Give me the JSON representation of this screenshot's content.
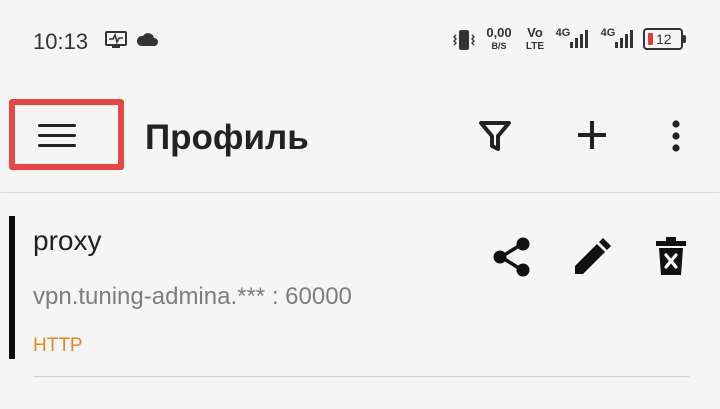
{
  "status_bar": {
    "time": "10:13",
    "net_speed_value": "0,00",
    "net_speed_unit": "B/S",
    "volte_top": "Vo",
    "volte_bottom": "LTE",
    "sim1_label": "4G",
    "sim2_label": "4G",
    "battery": "12",
    "battery_color": "#e53935",
    "icons": [
      "activity-monitor-icon",
      "cloud-icon",
      "vibrate-icon",
      "signal-icon",
      "battery-icon"
    ]
  },
  "app_bar": {
    "title": "Профиль",
    "highlight_color": "#e84545",
    "actions": [
      "filter-icon",
      "add-icon",
      "more-vert-icon"
    ]
  },
  "profiles": [
    {
      "name": "proxy",
      "address": "vpn.tuning-admina.*** : 60000",
      "type": "HTTP",
      "type_color": "#e08a1e",
      "actions": [
        "share-icon",
        "edit-icon",
        "delete-icon"
      ]
    }
  ]
}
